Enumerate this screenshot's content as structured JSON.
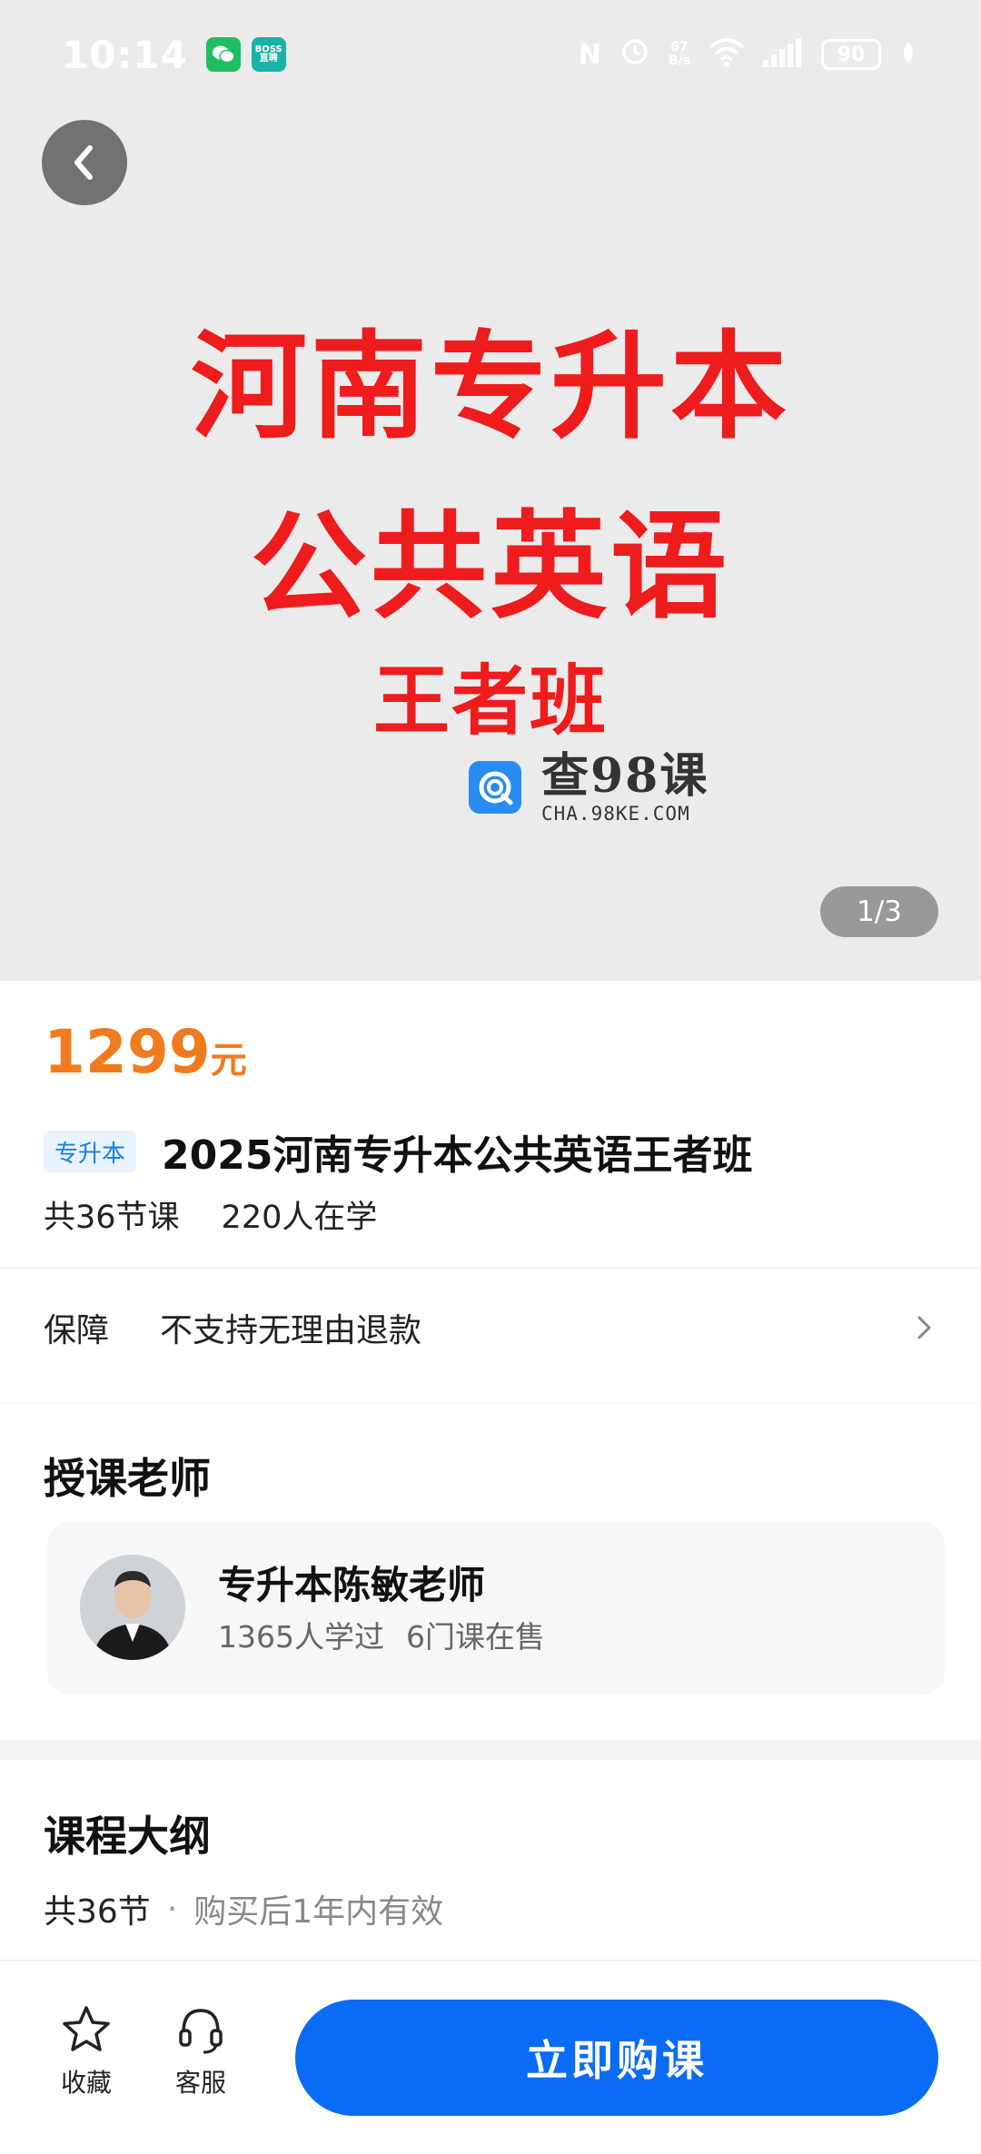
{
  "status_bar": {
    "time": "10:14",
    "apps": [
      "WeChat",
      "BOSS直聘"
    ],
    "boss_icon_text": "BOSS 直聘",
    "network_speed": "67\nB/s",
    "battery": "90"
  },
  "gallery": {
    "cover_line1": "河南专升本",
    "cover_line2": "公共英语",
    "cover_line3": "王者班",
    "brand_name": "查98课",
    "brand_domain": "CHA.98KE.COM",
    "pager": "1/3"
  },
  "course": {
    "price": "1299",
    "price_unit": "元",
    "tag": "专升本",
    "title": "2025河南专升本公共英语王者班",
    "lessons": "共36节课",
    "students": "220人在学",
    "guarantee_label": "保障",
    "guarantee_value": "不支持无理由退款"
  },
  "teacher": {
    "section_title": "授课老师",
    "name": "专升本陈敏老师",
    "learners": "1365人学过",
    "courses": "6门课在售"
  },
  "syllabus": {
    "section_title": "课程大纲",
    "count": "共36节",
    "separator": "·",
    "validity": "购买后1年内有效"
  },
  "bottom_bar": {
    "favorite_label": "收藏",
    "service_label": "客服",
    "buy_label": "立即购课"
  },
  "colors": {
    "price": "#f07b1e",
    "primary": "#0a6cf5",
    "cover_text": "#ee1c1c",
    "tag_bg": "#e7f3ff",
    "tag_text": "#1a7fe6"
  }
}
